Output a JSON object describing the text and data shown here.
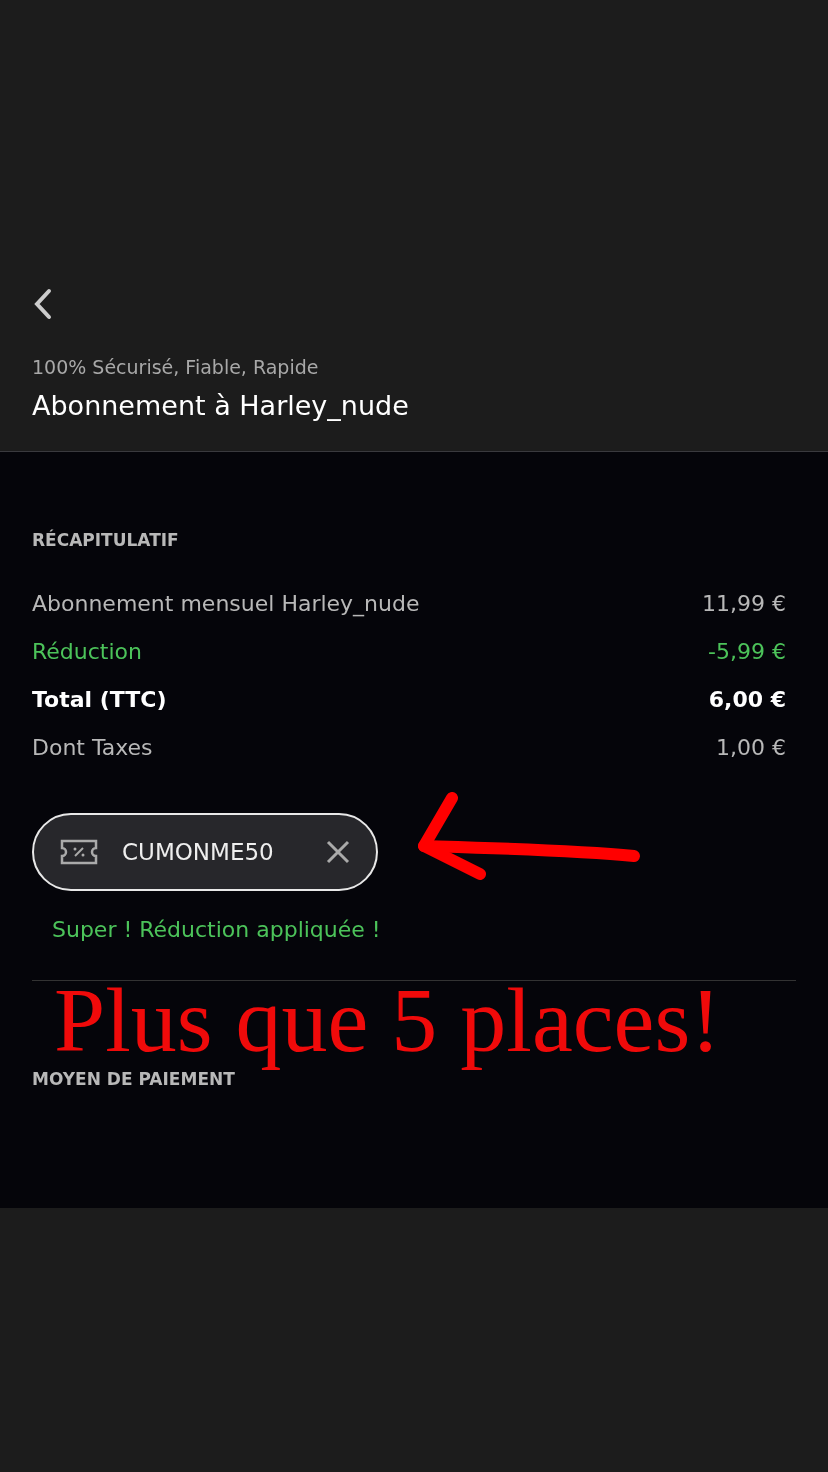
{
  "header": {
    "tagline": "100% Sécurisé, Fiable, Rapide",
    "title": "Abonnement à Harley_nude"
  },
  "summary": {
    "heading": "RÉCAPITULATIF",
    "rows": [
      {
        "kind": "item",
        "label": "Abonnement mensuel Harley_nude",
        "amount": "11,99 €"
      },
      {
        "kind": "discount",
        "label": "Réduction",
        "amount": "-5,99 €"
      },
      {
        "kind": "total",
        "label": "Total (TTC)",
        "amount": "6,00 €"
      },
      {
        "kind": "item",
        "label": "Dont Taxes",
        "amount": "1,00 €"
      }
    ]
  },
  "promo": {
    "code": "CUMONME50",
    "message": "Super ! Réduction appliquée !"
  },
  "annotation": {
    "text": "Plus que 5 places!"
  },
  "payment": {
    "heading": "MOYEN DE PAIEMENT"
  }
}
